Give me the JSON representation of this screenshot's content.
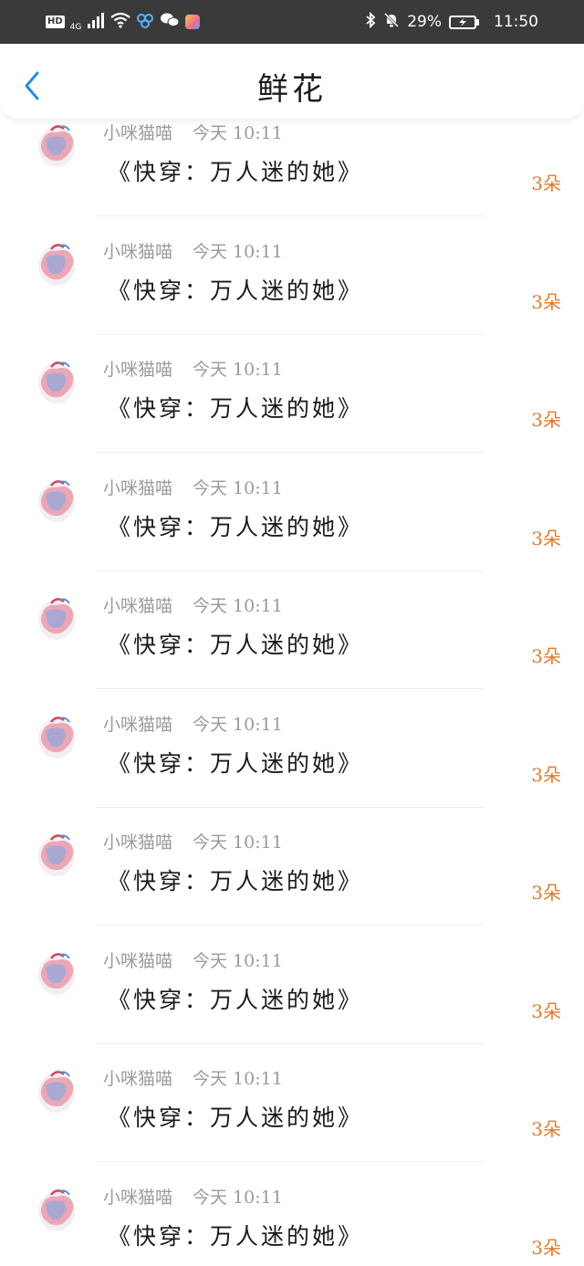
{
  "status_bar": {
    "network_badge": "HD",
    "network_type": "4G",
    "battery_percent": "29%",
    "time": "11:50"
  },
  "header": {
    "title": "鲜花"
  },
  "colors": {
    "accent_blue": "#1e90e6",
    "count_orange": "#e07a2e",
    "meta_gray": "#9a9a9a"
  },
  "items": [
    {
      "user": "小咪猫喵",
      "time": "今天 10:11",
      "title": "《快穿：万人迷的她》",
      "count": "3朵"
    },
    {
      "user": "小咪猫喵",
      "time": "今天 10:11",
      "title": "《快穿：万人迷的她》",
      "count": "3朵"
    },
    {
      "user": "小咪猫喵",
      "time": "今天 10:11",
      "title": "《快穿：万人迷的她》",
      "count": "3朵"
    },
    {
      "user": "小咪猫喵",
      "time": "今天 10:11",
      "title": "《快穿：万人迷的她》",
      "count": "3朵"
    },
    {
      "user": "小咪猫喵",
      "time": "今天 10:11",
      "title": "《快穿：万人迷的她》",
      "count": "3朵"
    },
    {
      "user": "小咪猫喵",
      "time": "今天 10:11",
      "title": "《快穿：万人迷的她》",
      "count": "3朵"
    },
    {
      "user": "小咪猫喵",
      "time": "今天 10:11",
      "title": "《快穿：万人迷的她》",
      "count": "3朵"
    },
    {
      "user": "小咪猫喵",
      "time": "今天 10:11",
      "title": "《快穿：万人迷的她》",
      "count": "3朵"
    },
    {
      "user": "小咪猫喵",
      "time": "今天 10:11",
      "title": "《快穿：万人迷的她》",
      "count": "3朵"
    },
    {
      "user": "小咪猫喵",
      "time": "今天 10:11",
      "title": "《快穿：万人迷的她》",
      "count": "3朵"
    }
  ]
}
